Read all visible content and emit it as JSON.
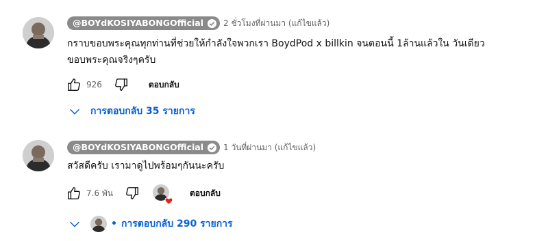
{
  "comments": [
    {
      "author": "@BOYdKOSIYABONGOfficial",
      "timestamp": "2 ชั่วโมงที่ผ่านมา (แก้ไขแล้ว)",
      "text_line1": "กราบขอบพระคุณทุกท่านที่ช่วยให้กำลังใจพวกเรา BoydPod x billkin จนตอนนี้ 1ล้านแล้วใน วันเดียว",
      "text_line2": "ขอบพระคุณจริงๆครับ",
      "likes": "926",
      "reply_label": "ตอบกลับ",
      "replies_label": "การตอบกลับ 35 รายการ",
      "icons": [
        "verified-badge-icon",
        "like-icon",
        "dislike-icon",
        "chevron-down-icon"
      ]
    },
    {
      "author": "@BOYdKOSIYABONGOfficial",
      "timestamp": "1 วันที่ผ่านมา (แก้ไขแล้ว)",
      "text_line1": "สวัสดีครับ เรามาดูไปพร้อมๆกันนะครับ",
      "likes": "7.6 พัน",
      "reply_label": "ตอบกลับ",
      "replies_label": "การตอบกลับ 290 รายการ",
      "icons": [
        "verified-badge-icon",
        "like-icon",
        "dislike-icon",
        "creator-heart-icon",
        "chevron-down-icon"
      ]
    }
  ],
  "colors": {
    "link_blue": "#065fd4",
    "author_chip_bg": "#8a8a8a",
    "heart_red": "#e62117",
    "text_secondary": "#606060"
  }
}
